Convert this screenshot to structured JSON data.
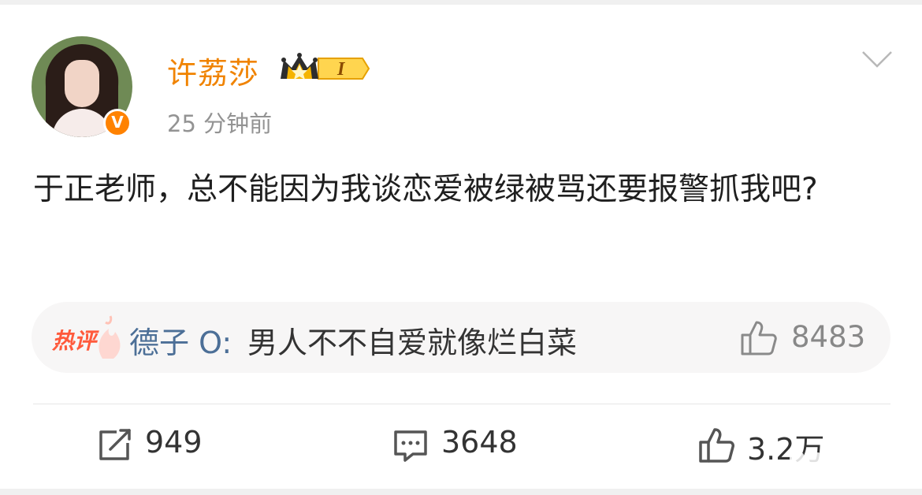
{
  "post": {
    "author": {
      "name": "许荔莎",
      "verified_badge": "V",
      "rank_badge": "I"
    },
    "time": "25 分钟前",
    "content": "于正老师，总不能因为我谈恋爱被绿被骂还要报警抓我吧?"
  },
  "hot_comment": {
    "label": "热评",
    "user": "德子 O:",
    "text": "男人不不自爱就像烂白菜",
    "likes": "8483"
  },
  "actions": {
    "repost_count": "949",
    "comment_count": "3648",
    "like_count": "3.2万"
  },
  "icons": {
    "menu": "chevron-down-icon",
    "repost": "repost-icon",
    "comment": "comment-icon",
    "like": "thumbs-up-icon",
    "crown": "crown-icon"
  },
  "colors": {
    "name": "#f08300",
    "time": "#939393",
    "hot_label": "#ff5a3c",
    "hot_user": "#4c6f97",
    "hot_bg": "#f7f6f6",
    "verified": "#ff8200"
  }
}
